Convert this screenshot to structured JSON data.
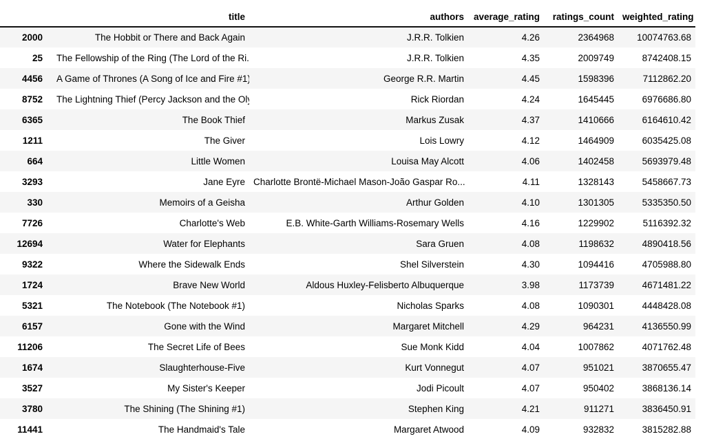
{
  "table": {
    "index_header": "",
    "columns": [
      "title",
      "authors",
      "average_rating",
      "ratings_count",
      "weighted_rating"
    ],
    "rows": [
      {
        "index": "2000",
        "title": "The Hobbit or There and Back Again",
        "authors": "J.R.R. Tolkien",
        "average_rating": "4.26",
        "ratings_count": "2364968",
        "weighted_rating": "10074763.68"
      },
      {
        "index": "25",
        "title": "The Fellowship of the Ring (The Lord of the Ri...",
        "authors": "J.R.R. Tolkien",
        "average_rating": "4.35",
        "ratings_count": "2009749",
        "weighted_rating": "8742408.15"
      },
      {
        "index": "4456",
        "title": "A Game of Thrones (A Song of Ice and Fire #1)",
        "authors": "George R.R. Martin",
        "average_rating": "4.45",
        "ratings_count": "1598396",
        "weighted_rating": "7112862.20"
      },
      {
        "index": "8752",
        "title": "The Lightning Thief (Percy Jackson and the Oly...",
        "authors": "Rick Riordan",
        "average_rating": "4.24",
        "ratings_count": "1645445",
        "weighted_rating": "6976686.80"
      },
      {
        "index": "6365",
        "title": "The Book Thief",
        "authors": "Markus Zusak",
        "average_rating": "4.37",
        "ratings_count": "1410666",
        "weighted_rating": "6164610.42"
      },
      {
        "index": "1211",
        "title": "The Giver",
        "authors": "Lois Lowry",
        "average_rating": "4.12",
        "ratings_count": "1464909",
        "weighted_rating": "6035425.08"
      },
      {
        "index": "664",
        "title": "Little Women",
        "authors": "Louisa May Alcott",
        "average_rating": "4.06",
        "ratings_count": "1402458",
        "weighted_rating": "5693979.48"
      },
      {
        "index": "3293",
        "title": "Jane Eyre",
        "authors": "Charlotte Brontë-Michael Mason-João Gaspar Ro...",
        "average_rating": "4.11",
        "ratings_count": "1328143",
        "weighted_rating": "5458667.73"
      },
      {
        "index": "330",
        "title": "Memoirs of a Geisha",
        "authors": "Arthur Golden",
        "average_rating": "4.10",
        "ratings_count": "1301305",
        "weighted_rating": "5335350.50"
      },
      {
        "index": "7726",
        "title": "Charlotte's Web",
        "authors": "E.B. White-Garth Williams-Rosemary Wells",
        "average_rating": "4.16",
        "ratings_count": "1229902",
        "weighted_rating": "5116392.32"
      },
      {
        "index": "12694",
        "title": "Water for Elephants",
        "authors": "Sara Gruen",
        "average_rating": "4.08",
        "ratings_count": "1198632",
        "weighted_rating": "4890418.56"
      },
      {
        "index": "9322",
        "title": "Where the Sidewalk Ends",
        "authors": "Shel Silverstein",
        "average_rating": "4.30",
        "ratings_count": "1094416",
        "weighted_rating": "4705988.80"
      },
      {
        "index": "1724",
        "title": "Brave New World",
        "authors": "Aldous Huxley-Felisberto Albuquerque",
        "average_rating": "3.98",
        "ratings_count": "1173739",
        "weighted_rating": "4671481.22"
      },
      {
        "index": "5321",
        "title": "The Notebook (The Notebook #1)",
        "authors": "Nicholas Sparks",
        "average_rating": "4.08",
        "ratings_count": "1090301",
        "weighted_rating": "4448428.08"
      },
      {
        "index": "6157",
        "title": "Gone with the Wind",
        "authors": "Margaret Mitchell",
        "average_rating": "4.29",
        "ratings_count": "964231",
        "weighted_rating": "4136550.99"
      },
      {
        "index": "11206",
        "title": "The Secret Life of Bees",
        "authors": "Sue Monk Kidd",
        "average_rating": "4.04",
        "ratings_count": "1007862",
        "weighted_rating": "4071762.48"
      },
      {
        "index": "1674",
        "title": "Slaughterhouse-Five",
        "authors": "Kurt Vonnegut",
        "average_rating": "4.07",
        "ratings_count": "951021",
        "weighted_rating": "3870655.47"
      },
      {
        "index": "3527",
        "title": "My Sister's Keeper",
        "authors": "Jodi Picoult",
        "average_rating": "4.07",
        "ratings_count": "950402",
        "weighted_rating": "3868136.14"
      },
      {
        "index": "3780",
        "title": "The Shining (The Shining #1)",
        "authors": "Stephen King",
        "average_rating": "4.21",
        "ratings_count": "911271",
        "weighted_rating": "3836450.91"
      },
      {
        "index": "11441",
        "title": "The Handmaid's Tale",
        "authors": "Margaret Atwood",
        "average_rating": "4.09",
        "ratings_count": "932832",
        "weighted_rating": "3815282.88"
      }
    ]
  },
  "style": {
    "stripe_color": "#f5f5f5",
    "text_color": "#000000",
    "header_rule_color": "#111111",
    "background": "#ffffff"
  }
}
